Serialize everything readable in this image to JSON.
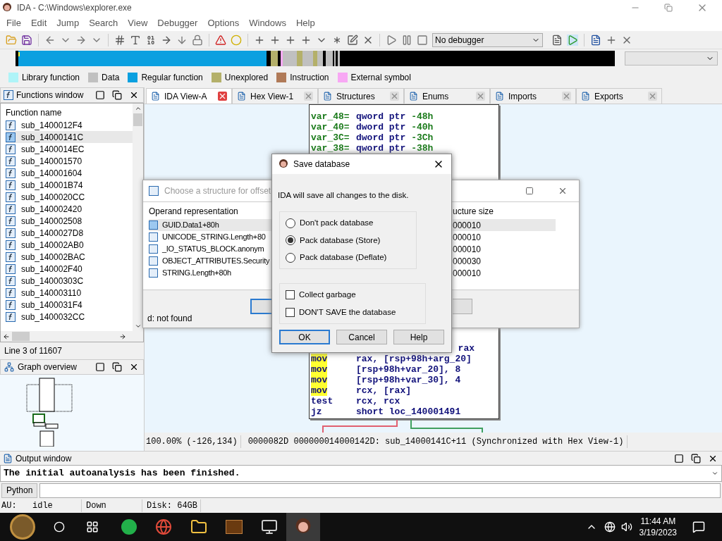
{
  "window": {
    "title": "IDA - C:\\Windows\\explorer.exe"
  },
  "menu": [
    "File",
    "Edit",
    "Jump",
    "Search",
    "View",
    "Debugger",
    "Options",
    "Windows",
    "Help"
  ],
  "toolbar": {
    "debugger": "No debugger"
  },
  "legend": [
    {
      "label": "Library function",
      "color": "#aef4f8"
    },
    {
      "label": "Data",
      "color": "#c0c0c0"
    },
    {
      "label": "Regular function",
      "color": "#0aa0e0"
    },
    {
      "label": "Unexplored",
      "color": "#b4b06a"
    },
    {
      "label": "Instruction",
      "color": "#b07a58"
    },
    {
      "label": "External symbol",
      "color": "#f8a8f4"
    }
  ],
  "functions_window": {
    "title": "Functions window",
    "column": "Function name",
    "items": [
      {
        "name": "sub_1400012F4",
        "selected": false
      },
      {
        "name": "sub_14000141C",
        "selected": true
      },
      {
        "name": "sub_1400014EC",
        "selected": false
      },
      {
        "name": "sub_140001570",
        "selected": false
      },
      {
        "name": "sub_140001604",
        "selected": false
      },
      {
        "name": "sub_140001B74",
        "selected": false
      },
      {
        "name": "sub_1400020CC",
        "selected": false
      },
      {
        "name": "sub_140002420",
        "selected": false
      },
      {
        "name": "sub_140002508",
        "selected": false
      },
      {
        "name": "sub_1400027D8",
        "selected": false
      },
      {
        "name": "sub_140002AB0",
        "selected": false
      },
      {
        "name": "sub_140002BAC",
        "selected": false
      },
      {
        "name": "sub_140002F40",
        "selected": false
      },
      {
        "name": "sub_14000303C",
        "selected": false
      },
      {
        "name": "sub_140003110",
        "selected": false
      },
      {
        "name": "sub_1400031F4",
        "selected": false
      },
      {
        "name": "sub_1400032CC",
        "selected": false
      }
    ],
    "line_info": "Line 3 of 11607"
  },
  "graph_overview": {
    "title": "Graph overview"
  },
  "tabs": [
    {
      "label": "IDA View-A",
      "selected": true
    },
    {
      "label": "Hex View-1",
      "selected": false
    },
    {
      "label": "Structures",
      "selected": false
    },
    {
      "label": "Enums",
      "selected": false
    },
    {
      "label": "Imports",
      "selected": false
    },
    {
      "label": "Exports",
      "selected": false
    }
  ],
  "disassembly": {
    "var_lines": [
      {
        "name": "var_48=",
        "type": "qword ptr",
        "offset": "-48h"
      },
      {
        "name": "var_40=",
        "type": "dword ptr",
        "offset": "-40h"
      },
      {
        "name": "var_3C=",
        "type": "dword ptr",
        "offset": "-3Ch"
      },
      {
        "name": "var_38=",
        "type": "qword ptr",
        "offset": "-38h"
      }
    ],
    "fragment": "rax",
    "instructions": [
      {
        "mnemonic": "mov",
        "operands": "rax, [rsp+98h+arg_20]",
        "highlighted": true
      },
      {
        "mnemonic": "mov",
        "operands": "[rsp+98h+var_20], 8",
        "highlighted": true
      },
      {
        "mnemonic": "mov",
        "operands": "[rsp+98h+var_30], 4",
        "highlighted": true
      },
      {
        "mnemonic": "mov",
        "operands": "rcx, [rax]",
        "highlighted": true
      },
      {
        "mnemonic": "test",
        "operands": "rcx, rcx",
        "highlighted": false
      },
      {
        "mnemonic": "jz",
        "operands": "short loc_140001491",
        "highlighted": false
      }
    ]
  },
  "view_status": [
    "100.00% (-126,134)",
    "0000082D 000000014000142D: sub_14000141C+11 (Synchronized with Hex View-1)"
  ],
  "struct_dialog": {
    "title": "Choose a structure for offset",
    "columns": [
      "Operand representation",
      "ucture size"
    ],
    "rows": [
      {
        "name": "GUID.Data1+80h",
        "size": "000010",
        "selected": true
      },
      {
        "name": "UNICODE_STRING.Length+80",
        "size": "000010",
        "selected": false
      },
      {
        "name": "_IO_STATUS_BLOCK.anonym",
        "size": "000010",
        "selected": false
      },
      {
        "name": "OBJECT_ATTRIBUTES.Security",
        "size": "000030",
        "selected": false
      },
      {
        "name": "STRING.Length+80h",
        "size": "000010",
        "selected": false
      }
    ],
    "status": "d: not found"
  },
  "save_dialog": {
    "title": "Save database",
    "message": "IDA will save all changes to the disk.",
    "options": [
      {
        "label": "Don't pack database",
        "selected": false
      },
      {
        "label": "Pack database (Store)",
        "selected": true
      },
      {
        "label": "Pack database (Deflate)",
        "selected": false
      }
    ],
    "checks": [
      {
        "label": "Collect garbage",
        "checked": false
      },
      {
        "label": "DON'T SAVE the database",
        "checked": false
      }
    ],
    "buttons": [
      {
        "label": "OK",
        "default": true
      },
      {
        "label": "Cancel",
        "default": false
      },
      {
        "label": "Help",
        "default": false
      }
    ]
  },
  "output_window": {
    "title": "Output window",
    "text": "The initial autoanalysis has been finished.",
    "language": "Python"
  },
  "status_bar": [
    "AU:",
    "idle",
    "Down",
    "Disk: 64GB"
  ],
  "taskbar": {
    "time": "11:44 AM",
    "date": "3/19/2023"
  }
}
